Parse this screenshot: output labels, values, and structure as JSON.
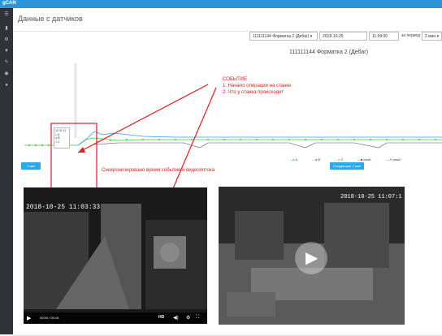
{
  "app": {
    "logo": "gCAN"
  },
  "page": {
    "title": "Данные с датчиков"
  },
  "filters": {
    "device": "111111144 Форматка 2 (Дебаг)",
    "date": "2018-10-25",
    "time": "11:09:00",
    "period_label": "за период",
    "period": "2 мин."
  },
  "chart": {
    "title": "111111144 Форматка 2 (Дебаг)",
    "event_tooltip": {
      "time": "11:07:11",
      "a": "A",
      "b": "B",
      "c": "C"
    },
    "legend": [
      "A",
      "B",
      "C",
      "реж1",
      "реж2"
    ]
  },
  "buttons": {
    "back": "2 мин",
    "forward": "Следующие 2 мин"
  },
  "annotation": {
    "title": "СОБЫТИЕ",
    "line1": "1. Начало операции на станке",
    "line2": "2. Что у станка происходит",
    "sync": "Синхронизировано время события и видеопотока"
  },
  "video1": {
    "timestamp": "2018-10-25 11:03:33",
    "time": "00:00 / 00:15",
    "hd": "HD"
  },
  "video2": {
    "timestamp": "2018-10-25 11:07:1"
  },
  "colors": {
    "accent": "#2d94d7",
    "seriesA": "#3b9be0",
    "seriesC": "#6dd46d",
    "annotation": "#e02020"
  }
}
